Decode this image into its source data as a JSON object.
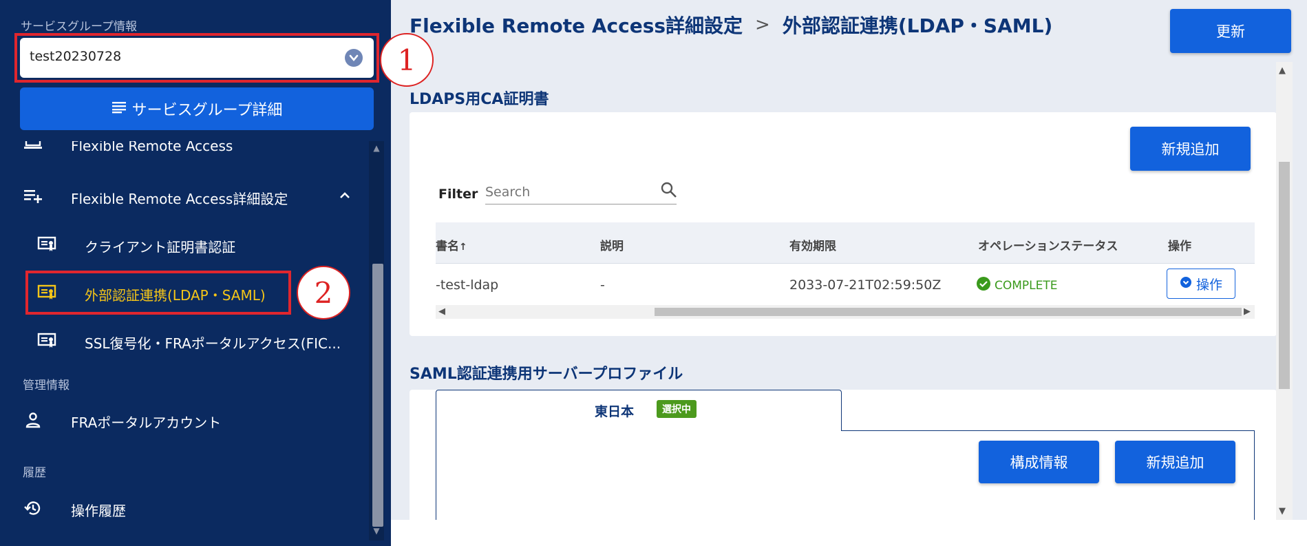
{
  "sidebar": {
    "service_group_caption": "サービスグループ情報",
    "service_group_value": "test20230728",
    "service_group_detail_label": "サービスグループ詳細",
    "nav": [
      {
        "label": "Flexible Remote Access",
        "icon": "laptop-icon"
      },
      {
        "label": "Flexible Remote Access詳細設定",
        "icon": "playlist-add-icon"
      },
      {
        "label": "クライアント証明書認証",
        "icon": "certificate-icon"
      },
      {
        "label": "外部認証連携(LDAP・SAML)",
        "icon": "certificate-icon"
      },
      {
        "label": "SSL復号化・FRAポータルアクセス(FIC...",
        "icon": "certificate-icon"
      }
    ],
    "section_management": "管理情報",
    "management_items": [
      {
        "label": "FRAポータルアカウント",
        "icon": "person-icon"
      }
    ],
    "section_history": "履歴",
    "history_items": [
      {
        "label": "操作履歴",
        "icon": "history-icon"
      }
    ]
  },
  "annotations": {
    "marker_1": "1",
    "marker_2": "2"
  },
  "main": {
    "breadcrumb_parent": "Flexible Remote Access詳細設定",
    "breadcrumb_separator": ">",
    "breadcrumb_current": "外部認証連携(LDAP・SAML)",
    "update_label": "更新",
    "ldaps": {
      "title": "LDAPS用CA証明書",
      "add_label": "新規追加",
      "filter_label": "Filter",
      "search_placeholder": "Search",
      "columns": [
        "書名",
        "説明",
        "有効期限",
        "オペレーションステータス",
        "操作"
      ],
      "rows": [
        {
          "name": "-test-ldap",
          "description": "-",
          "expiry": "2033-07-21T02:59:50Z",
          "status": "COMPLETE",
          "op_label": "操作"
        }
      ]
    },
    "saml": {
      "title": "SAML認証連携用サーバープロファイル",
      "tab_label": "東日本",
      "tab_badge": "選択中",
      "config_label": "構成情報",
      "add_label": "新規追加"
    }
  },
  "colors": {
    "sidebar_bg": "#0b2a60",
    "accent_blue": "#1262dd",
    "selected_nav": "#f5c518",
    "status_green": "#3a9a1c",
    "annotation_red": "#e0262e"
  }
}
